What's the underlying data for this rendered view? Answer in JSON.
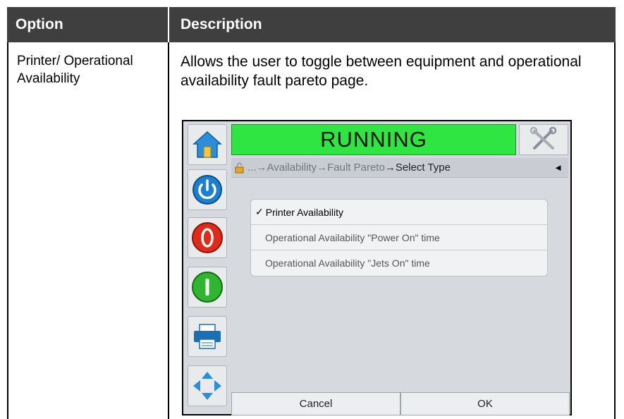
{
  "table": {
    "header": {
      "option": "Option",
      "description": "Description"
    },
    "rows": [
      {
        "option": "Printer/ Operational Availability",
        "description": "Allows the user to toggle between equipment and operational availability fault pareto page."
      }
    ]
  },
  "screenshot": {
    "status": "RUNNING",
    "breadcrumb": {
      "prefix": "... ",
      "dim": "→Availability→Fault Pareto",
      "current": "→Select Type",
      "back": "◄"
    },
    "options": [
      {
        "label": "Printer Availability",
        "selected": true,
        "check": "✓"
      },
      {
        "label": "Operational Availability \"Power On\" time",
        "selected": false
      },
      {
        "label": "Operational Availability \"Jets On\" time",
        "selected": false
      }
    ],
    "buttons": {
      "cancel": "Cancel",
      "ok": "OK"
    },
    "colors": {
      "status_bg": "#2ee541",
      "start_btn": "#2fb52f",
      "stop_btn": "#e02a1a",
      "power_btn": "#1d7fd0"
    },
    "icons": [
      "home-icon",
      "tools-icon",
      "lock-icon",
      "power-icon",
      "stop-icon",
      "start-icon",
      "printer-icon",
      "navigate-icon"
    ]
  }
}
